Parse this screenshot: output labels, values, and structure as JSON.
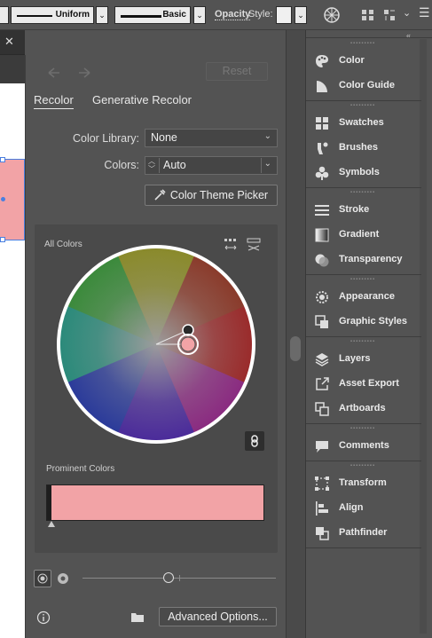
{
  "toolbar": {
    "stroke_profile": "Uniform",
    "brush": "Basic",
    "opacity_label": "Opacity",
    "style_label": "Style:"
  },
  "panel": {
    "reset_label": "Reset",
    "tabs": [
      {
        "label": "Recolor",
        "active": true
      },
      {
        "label": "Generative Recolor",
        "active": false
      }
    ],
    "color_library_label": "Color Library:",
    "color_library_value": "None",
    "colors_label": "Colors:",
    "colors_value": "Auto",
    "theme_picker_label": "Color Theme Picker",
    "all_colors_label": "All Colors",
    "prominent_colors_label": "Prominent Colors",
    "prominent_color": "#f2a3a6",
    "advanced_options_label": "Advanced Options..."
  },
  "dock": {
    "groups": [
      [
        {
          "label": "Color",
          "icon": "palette-icon"
        },
        {
          "label": "Color Guide",
          "icon": "color-guide-icon"
        }
      ],
      [
        {
          "label": "Swatches",
          "icon": "swatches-icon"
        },
        {
          "label": "Brushes",
          "icon": "brushes-icon"
        },
        {
          "label": "Symbols",
          "icon": "symbols-icon"
        }
      ],
      [
        {
          "label": "Stroke",
          "icon": "stroke-icon"
        },
        {
          "label": "Gradient",
          "icon": "gradient-icon"
        },
        {
          "label": "Transparency",
          "icon": "transparency-icon"
        }
      ],
      [
        {
          "label": "Appearance",
          "icon": "appearance-icon"
        },
        {
          "label": "Graphic Styles",
          "icon": "graphic-styles-icon"
        }
      ],
      [
        {
          "label": "Layers",
          "icon": "layers-icon"
        },
        {
          "label": "Asset Export",
          "icon": "asset-export-icon"
        },
        {
          "label": "Artboards",
          "icon": "artboards-icon"
        }
      ],
      [
        {
          "label": "Comments",
          "icon": "comments-icon"
        }
      ],
      [
        {
          "label": "Transform",
          "icon": "transform-icon"
        },
        {
          "label": "Align",
          "icon": "align-icon"
        },
        {
          "label": "Pathfinder",
          "icon": "pathfinder-icon"
        }
      ]
    ]
  }
}
